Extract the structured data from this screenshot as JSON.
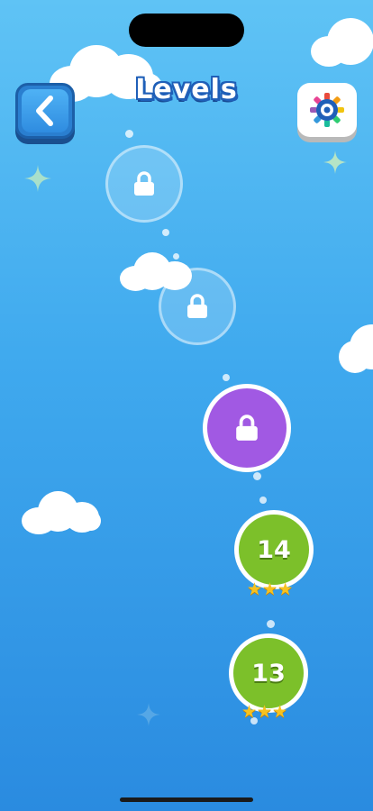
{
  "header": {
    "title": "Levels",
    "back_icon": "chevron-left-icon",
    "settings_icon": "gear-icon"
  },
  "levels": [
    {
      "state": "locked",
      "icon": "lock-icon"
    },
    {
      "state": "locked",
      "icon": "lock-icon"
    },
    {
      "state": "locked-next",
      "icon": "lock-icon"
    },
    {
      "number": "14",
      "state": "completed",
      "stars": 3
    },
    {
      "number": "13",
      "state": "completed",
      "stars": 3
    }
  ],
  "colors": {
    "background_top": "#5fc3f5",
    "background_bottom": "#2a8be0",
    "completed": "#7cc02a",
    "next_level": "#a159e3",
    "star": "#f7c21f"
  }
}
